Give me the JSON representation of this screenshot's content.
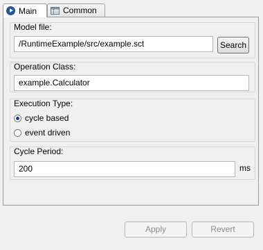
{
  "tabs": [
    {
      "label": "Main",
      "icon": "play-icon"
    },
    {
      "label": "Common",
      "icon": "table-icon"
    }
  ],
  "model_file": {
    "title": "Model file:",
    "value": "/RuntimeExample/src/example.sct",
    "search_label": "Search"
  },
  "operation_class": {
    "title": "Operation Class:",
    "value": "example.Calculator"
  },
  "execution_type": {
    "title": "Execution Type:",
    "options": [
      {
        "label": "cycle based",
        "selected": true
      },
      {
        "label": "event driven",
        "selected": false
      }
    ]
  },
  "cycle_period": {
    "title": "Cycle Period:",
    "value": "200",
    "unit": "ms"
  },
  "actions": {
    "apply_label": "Apply",
    "revert_label": "Revert"
  }
}
